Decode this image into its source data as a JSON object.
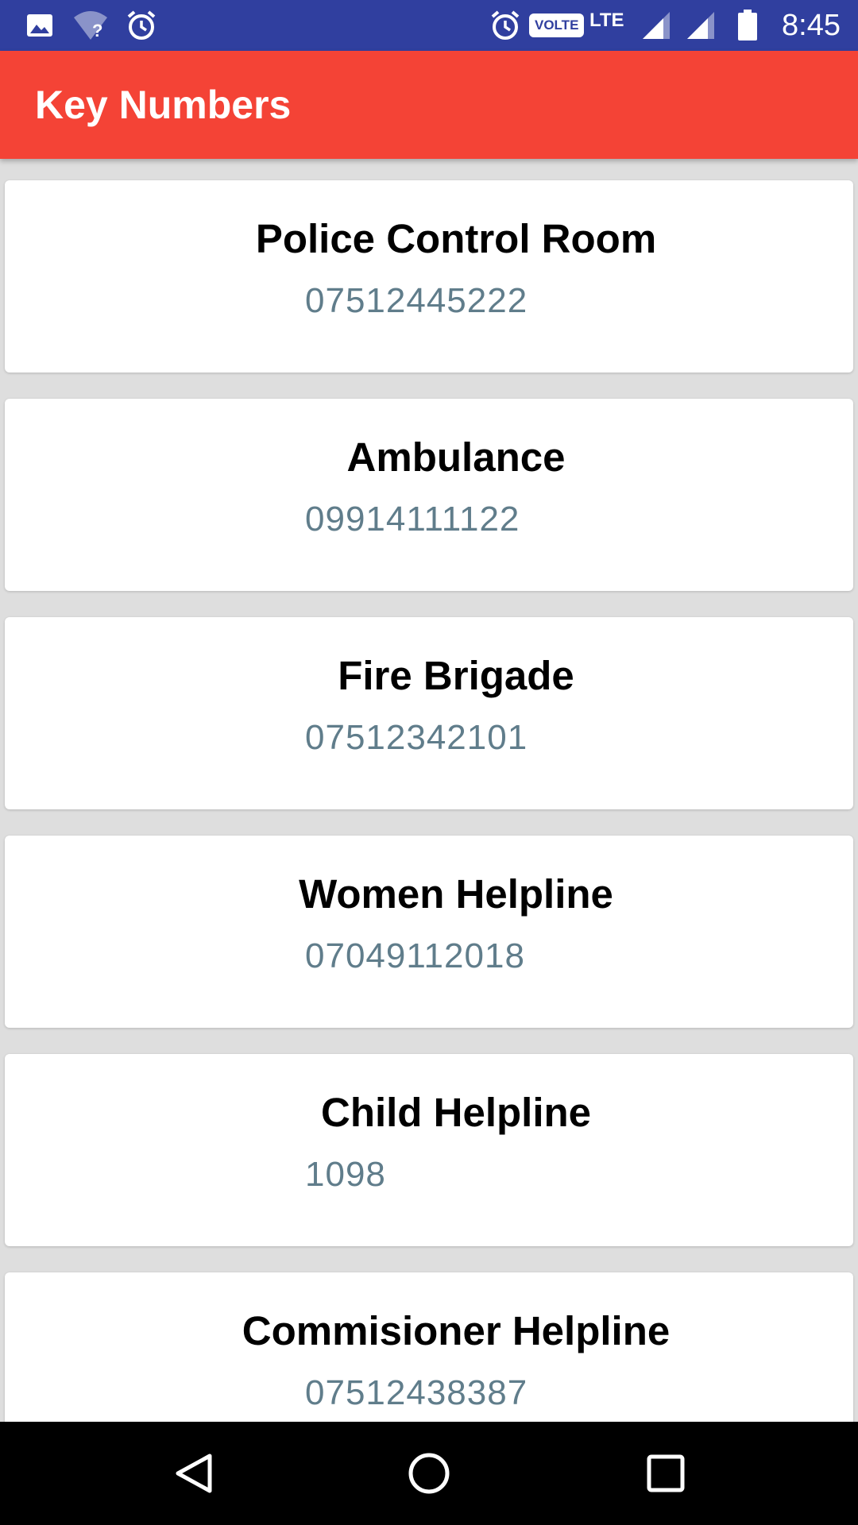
{
  "status_bar": {
    "time": "8:45",
    "volte": "VOLTE",
    "network": "LTE",
    "icons": [
      "image-icon",
      "wifi-unknown-icon",
      "alarm-icon",
      "alarm-icon",
      "signal-icon",
      "signal-icon",
      "battery-icon"
    ]
  },
  "app_bar": {
    "title": "Key Numbers",
    "color": "#f44336"
  },
  "contacts": [
    {
      "name": "Police Control Room",
      "number": "07512445222"
    },
    {
      "name": "Ambulance",
      "number": "09914111122"
    },
    {
      "name": "Fire Brigade",
      "number": "07512342101"
    },
    {
      "name": "Women Helpline",
      "number": "07049112018"
    },
    {
      "name": "Child Helpline",
      "number": "1098"
    },
    {
      "name": "Commisioner Helpline",
      "number": "07512438387"
    }
  ],
  "nav_bar": {
    "icons": [
      "back-icon",
      "home-icon",
      "recents-icon"
    ]
  },
  "colors": {
    "status_bar": "#303f9f",
    "app_bar": "#f44336",
    "number_text": "#607d8b",
    "background": "#dedede"
  }
}
